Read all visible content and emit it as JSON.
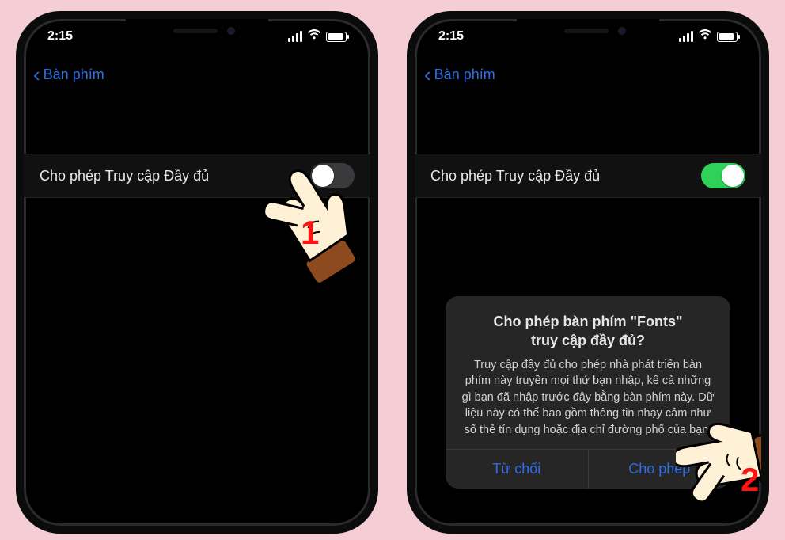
{
  "statusbar": {
    "time": "2:15"
  },
  "nav": {
    "back_label": "Bàn phím"
  },
  "setting": {
    "label": "Cho phép Truy cập Đầy đủ"
  },
  "hand_numbers": {
    "one": "1",
    "two": "2"
  },
  "alert": {
    "title_line1": "Cho phép bàn phím \"Fonts\"",
    "title_line2": "truy cập đầy đủ?",
    "message": "Truy cập đầy đủ cho phép nhà phát triển bàn phím này truyền mọi thứ bạn nhập, kể cả những gì bạn đã nhập trước đây bằng bàn phím này. Dữ liệu này có thể bao gồm thông tin nhạy cảm như số thẻ tín dụng hoặc địa chỉ đường phố của bạn.",
    "deny": "Từ chối",
    "allow": "Cho phép"
  }
}
